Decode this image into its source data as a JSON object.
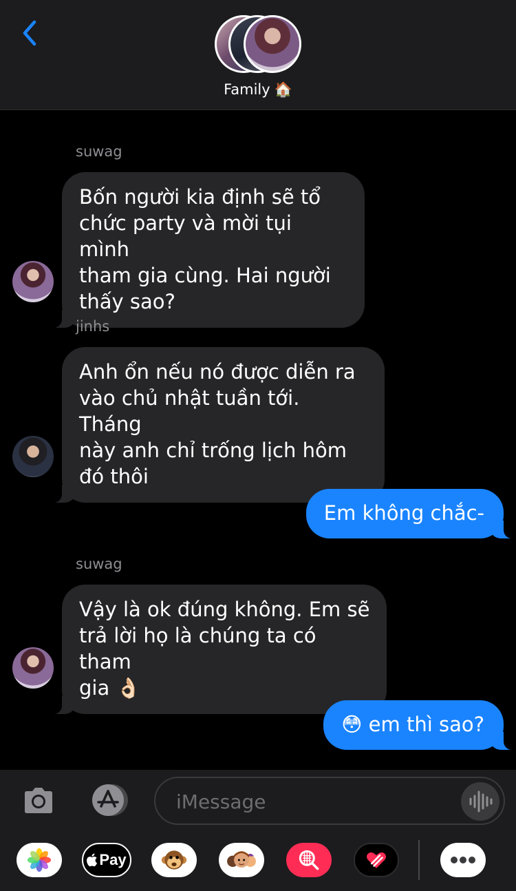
{
  "header": {
    "title": "Family",
    "title_emoji": "🏠",
    "back_icon": "chevron-left-icon",
    "accent_color": "#1a84ff"
  },
  "messages": [
    {
      "direction": "in",
      "sender": "suwag",
      "text": "Bốn người kia định sẽ tổ\nchức party và mời tụi mình\ntham gia cùng. Hai người\nthấy sao?"
    },
    {
      "direction": "in",
      "sender": "jinhs",
      "text": "Anh ổn nếu nó được diễn ra\nvào chủ nhật tuần tới. Tháng\nnày anh chỉ trống lịch hôm\nđó thôi"
    },
    {
      "direction": "out",
      "text": "Em không chắc-"
    },
    {
      "direction": "in",
      "sender": "suwag",
      "text": "Vậy là ok đúng không. Em sẽ\ntrả lời họ là chúng ta có tham\ngia 👌🏻"
    },
    {
      "direction": "out",
      "text": "😳 em thì sao?"
    }
  ],
  "input": {
    "placeholder": "iMessage"
  },
  "apps": {
    "applepay_label": "Pay",
    "icons": [
      "photos-icon",
      "apple-pay-icon",
      "animoji-icon",
      "memoji-icon",
      "image-search-icon",
      "digital-touch-icon",
      "more-icon"
    ]
  },
  "colors": {
    "incoming_bubble": "#262628",
    "outgoing_bubble": "#1a84ff",
    "bar_background": "#1c1c1e"
  }
}
